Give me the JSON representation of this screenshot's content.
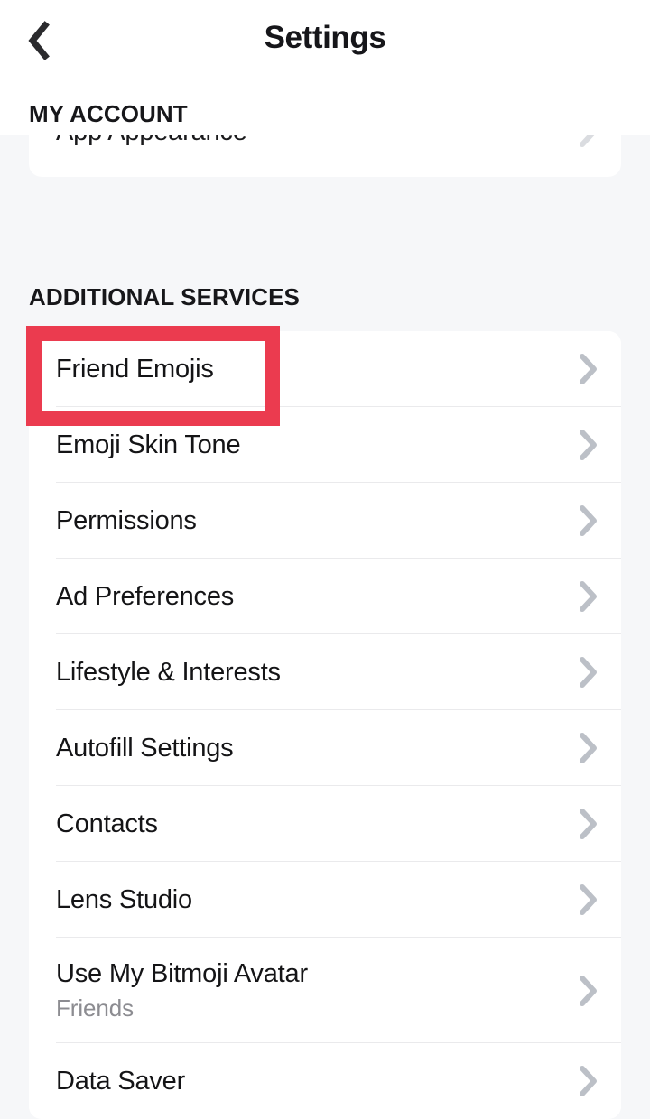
{
  "header": {
    "title": "Settings",
    "back_icon": "chevron-left-icon"
  },
  "colors": {
    "page_background": "#F6F7F9",
    "card_background": "#FFFFFF",
    "primary_text": "#141416",
    "secondary_text": "#8C8C91",
    "chevron": "#BCC0C7",
    "annotation_red": "#EB3B4F",
    "divider": "#EAEAEC"
  },
  "sections": [
    {
      "heading": "MY ACCOUNT",
      "partially_visible": true,
      "rows": [
        {
          "title": "App Appearance",
          "chevron_icon": "chevron-right-icon"
        }
      ]
    },
    {
      "heading": "ADDITIONAL SERVICES",
      "partially_visible": false,
      "rows": [
        {
          "title": "Friend Emojis",
          "chevron_icon": "chevron-right-icon"
        },
        {
          "title": "Emoji Skin Tone",
          "chevron_icon": "chevron-right-icon"
        },
        {
          "title": "Permissions",
          "chevron_icon": "chevron-right-icon"
        },
        {
          "title": "Ad Preferences",
          "chevron_icon": "chevron-right-icon"
        },
        {
          "title": "Lifestyle & Interests",
          "chevron_icon": "chevron-right-icon"
        },
        {
          "title": "Autofill Settings",
          "chevron_icon": "chevron-right-icon"
        },
        {
          "title": "Contacts",
          "chevron_icon": "chevron-right-icon"
        },
        {
          "title": "Lens Studio",
          "chevron_icon": "chevron-right-icon"
        },
        {
          "title": "Use My Bitmoji Avatar",
          "subtitle": "Friends",
          "chevron_icon": "chevron-right-icon"
        },
        {
          "title": "Data Saver",
          "chevron_icon": "chevron-right-icon"
        }
      ]
    }
  ],
  "annotation": {
    "target_row": "Friend Emojis",
    "shape": "rectangle-outline"
  }
}
